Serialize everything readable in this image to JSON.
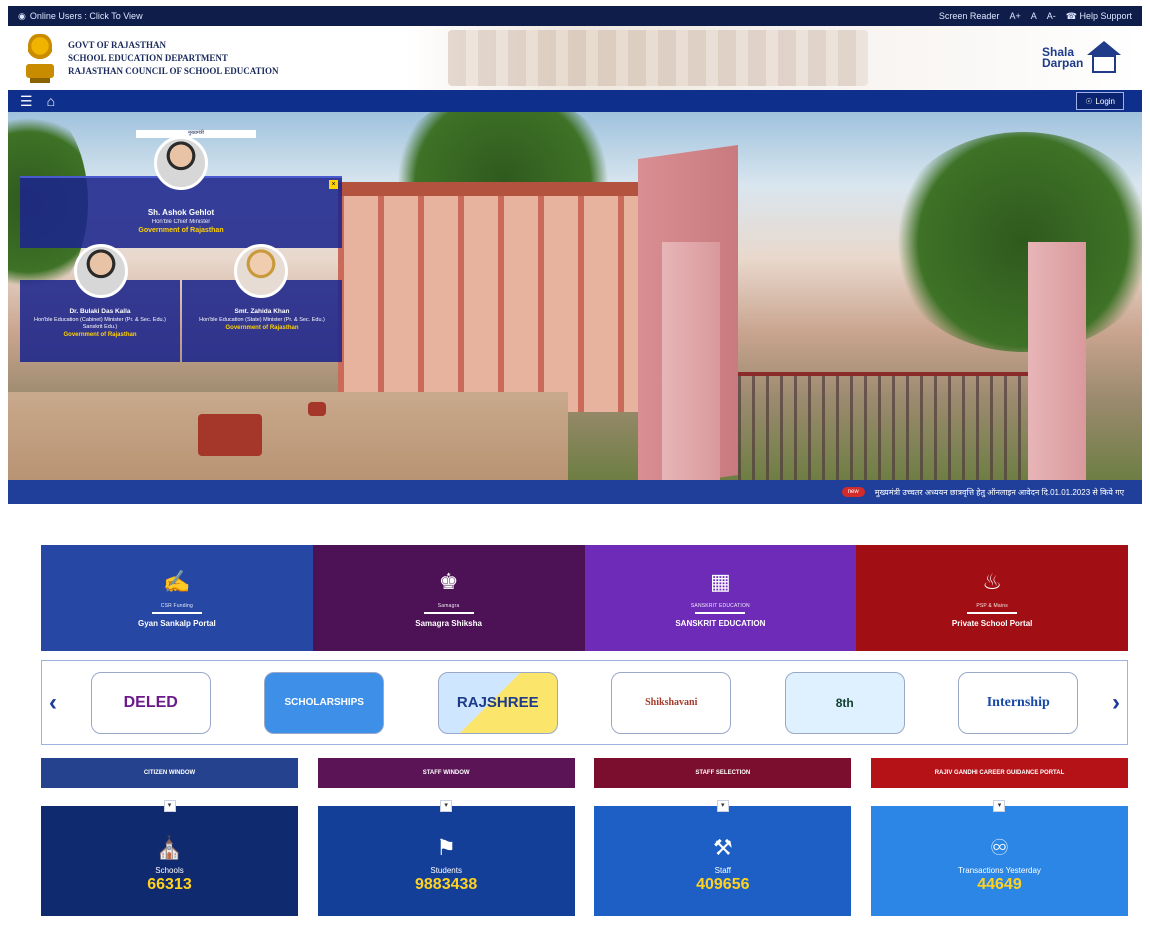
{
  "topbar": {
    "online_users": "Online Users : Click To View",
    "screen_reader": "Screen Reader",
    "font_increase": "A+",
    "font_normal": "A",
    "font_decrease": "A-",
    "help_support": "Help Support"
  },
  "header": {
    "line1": "GOVT OF RAJASTHAN",
    "line2": "SCHOOL EDUCATION DEPARTMENT",
    "line3": "RAJASTHAN COUNCIL OF SCHOOL EDUCATION",
    "logo_line1": "Shala",
    "logo_line2": "Darpan"
  },
  "navbar": {
    "menu_icon": "menu-icon",
    "home_icon": "home-icon",
    "login_label": "Login"
  },
  "hero": {
    "top_label": "मुख्यमंत्री",
    "cm": {
      "name": "Sh. Ashok Gehlot",
      "role": "Hon'ble Chief Minister",
      "govt": "Government of Rajasthan"
    },
    "ministers": [
      {
        "name": "Dr. Bulaki Das Kalla",
        "role": "Hon'ble Education (Cabinet) Minister (Pr. & Sec. Edu.) Sanskrit Edu.)",
        "govt": "Government of Rajasthan"
      },
      {
        "name": "Smt. Zahida Khan",
        "role": "Hon'ble Education (State) Minister (Pr. & Sec. Edu.)",
        "govt": "Government of Rajasthan"
      }
    ]
  },
  "ticker": {
    "badge": "new",
    "text": "मुख्यमंत्री उच्चतर अध्ययन छात्रवृत्ति हेतु ऑनलाइन आवेदन दि.01.01.2023 से किये गए"
  },
  "tiles": [
    {
      "sub": "CSR Funding",
      "title": "Gyan Sankalp Portal",
      "icon": "handshake-icon",
      "color": "#2647a4"
    },
    {
      "sub": "Samagra",
      "title": "Samagra Shiksha",
      "icon": "teacher-icon",
      "color": "#4d1256"
    },
    {
      "sub": "SANSKRIT EDUCATION",
      "title": "SANSKRIT EDUCATION",
      "icon": "books-icon",
      "color": "#6e2bb8"
    },
    {
      "sub": "PSP & Mains",
      "title": "Private School Portal",
      "icon": "school-bell-icon",
      "color": "#a10e13"
    }
  ],
  "carousel": {
    "prev_icon": "chevron-left-icon",
    "next_icon": "chevron-right-icon",
    "items": [
      {
        "label": "DELED"
      },
      {
        "label": "SCHOLARSHIPS"
      },
      {
        "label": "RAJSHREE"
      },
      {
        "label": "Shikshavani"
      },
      {
        "label": "8th"
      },
      {
        "label": "Internship"
      }
    ]
  },
  "buttons": [
    {
      "label": "CITIZEN WINDOW",
      "color": "#24428e"
    },
    {
      "label": "STAFF WINDOW",
      "color": "#5b1456"
    },
    {
      "label": "STAFF SELECTION",
      "color": "#7b0d2e"
    },
    {
      "label": "RAJIV GANDHI CAREER GUIDANCE PORTAL",
      "color": "#b51217"
    }
  ],
  "stats": [
    {
      "label": "Schools",
      "value": "66313",
      "icon": "school-icon",
      "color": "#102a6f"
    },
    {
      "label": "Students",
      "value": "9883438",
      "icon": "students-icon",
      "color": "#133f99"
    },
    {
      "label": "Staff",
      "value": "409656",
      "icon": "staff-icon",
      "color": "#1d5fc4"
    },
    {
      "label": "Transactions Yesterday",
      "value": "44649",
      "icon": "transactions-icon",
      "color": "#2b86e6"
    }
  ]
}
